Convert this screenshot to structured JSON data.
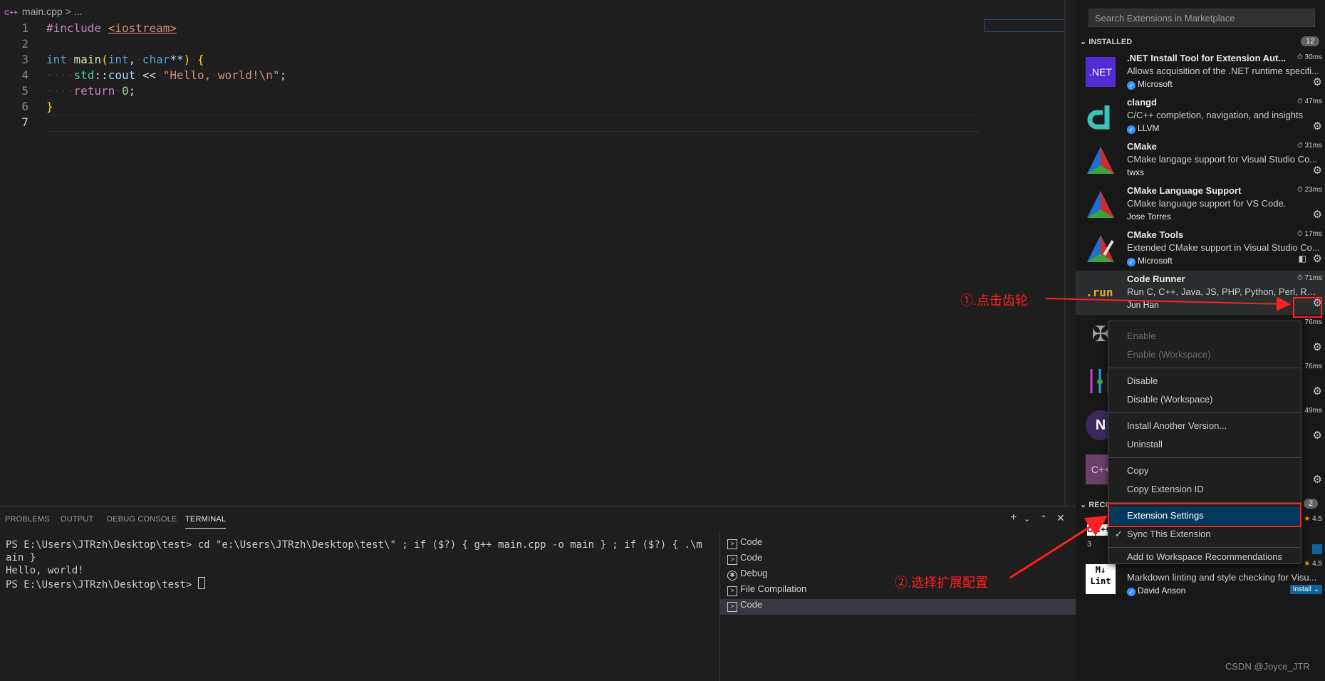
{
  "editor": {
    "breadcrumb_file": "main.cpp",
    "breadcrumb_sep": ">",
    "breadcrumb_rest": "...",
    "file_lang_badge": "C++",
    "line_numbers": [
      "1",
      "2",
      "3",
      "4",
      "5",
      "6",
      "7"
    ]
  },
  "panel": {
    "tabs": [
      "PROBLEMS",
      "OUTPUT",
      "DEBUG CONSOLE",
      "TERMINAL"
    ],
    "active_tab": "TERMINAL",
    "terminal_lines": [
      "PS E:\\Users\\JTRzh\\Desktop\\test> cd \"e:\\Users\\JTRzh\\Desktop\\test\\\" ; if ($?) { g++ main.cpp -o main } ; if ($?) { .\\m",
      "ain }",
      "Hello, world!",
      "PS E:\\Users\\JTRzh\\Desktop\\test> "
    ],
    "terminal_list": [
      "Code",
      "Code",
      "Debug",
      "File Compilation",
      "Code"
    ]
  },
  "sidebar": {
    "search_placeholder": "Search Extensions in Marketplace",
    "installed_label": "INSTALLED",
    "installed_count": "12",
    "recommended_label": "RECO",
    "recommended_count": "2",
    "extensions": [
      {
        "name": ".NET Install Tool for Extension Aut...",
        "desc": "Allows acquisition of the .NET runtime specifi...",
        "publisher": "Microsoft",
        "verified": true,
        "time": "30ms",
        "icon_text": ".NET"
      },
      {
        "name": "clangd",
        "desc": "C/C++ completion, navigation, and insights",
        "publisher": "LLVM",
        "verified": true,
        "time": "47ms",
        "icon_text": ""
      },
      {
        "name": "CMake",
        "desc": "CMake langage support for Visual Studio Co...",
        "publisher": "twxs",
        "verified": false,
        "time": "31ms",
        "icon_text": ""
      },
      {
        "name": "CMake Language Support",
        "desc": "CMake language support for VS Code.",
        "publisher": "Jose Torres",
        "verified": false,
        "time": "23ms",
        "icon_text": ""
      },
      {
        "name": "CMake Tools",
        "desc": "Extended CMake support in Visual Studio Co...",
        "publisher": "Microsoft",
        "verified": true,
        "time": "17ms",
        "icon_text": ""
      },
      {
        "name": "Code Runner",
        "desc": "Run C, C++, Java, JS, PHP, Python, Perl, Ruby...",
        "publisher": "Jun Han",
        "verified": false,
        "time": "71ms",
        "icon_text": ".run"
      }
    ],
    "partial_times": [
      "76ms",
      "76ms",
      "49ms"
    ],
    "recommended": [
      {
        "rating": "4.5",
        "icon_text": "C/C++",
        "count": "3"
      },
      {
        "rating": "4.5",
        "desc": "Markdown linting and style checking for Visu...",
        "publisher": "David Anson",
        "install_label": "Install",
        "icon_text": "M↓ Lint"
      }
    ]
  },
  "context_menu": {
    "items": [
      {
        "label": "Enable",
        "disabled": true
      },
      {
        "label": "Enable (Workspace)",
        "disabled": true
      },
      {
        "label": "Disable",
        "disabled": false
      },
      {
        "label": "Disable (Workspace)",
        "disabled": false
      },
      {
        "label": "Install Another Version...",
        "disabled": false
      },
      {
        "label": "Uninstall",
        "disabled": false
      },
      {
        "label": "Copy",
        "disabled": false
      },
      {
        "label": "Copy Extension ID",
        "disabled": false
      },
      {
        "label": "Extension Settings",
        "disabled": false,
        "selected": true
      },
      {
        "label": "Sync This Extension",
        "disabled": false,
        "checked": true
      },
      {
        "label": "Add to Workspace Recommendations",
        "disabled": false
      }
    ]
  },
  "annotations": {
    "step1": "①.点击齿轮",
    "step2": "②.选择扩展配置"
  },
  "watermark": "CSDN @Joyce_JTR"
}
